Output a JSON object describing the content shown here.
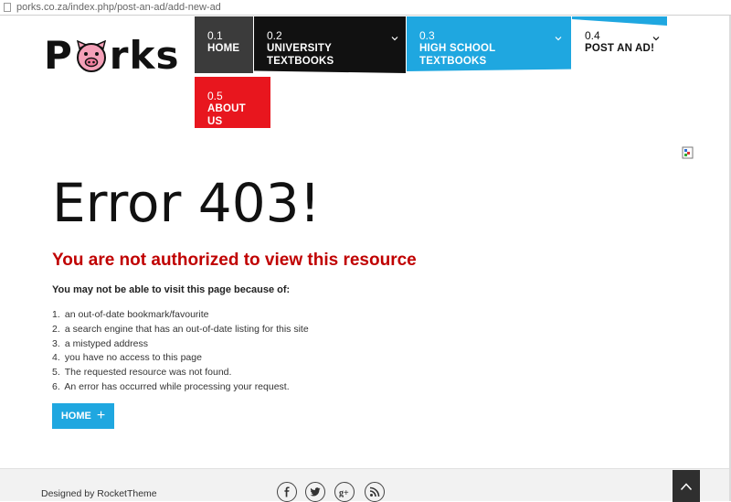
{
  "browser": {
    "url": "porks.co.za/index.php/post-an-ad/add-new-ad"
  },
  "logo": {
    "text_left": "P",
    "text_right": "rks"
  },
  "nav": [
    {
      "num": "0.1",
      "label": "HOME"
    },
    {
      "num": "0.2",
      "label": "UNIVERSITY TEXTBOOKS"
    },
    {
      "num": "0.3",
      "label": "HIGH SCHOOL TEXTBOOKS"
    },
    {
      "num": "0.4",
      "label": "POST AN AD!"
    },
    {
      "num": "0.5",
      "label": "ABOUT US"
    }
  ],
  "error": {
    "title": "Error 403!",
    "subtitle": "You are not authorized to view this resource",
    "intro": "You may not be able to visit this page because of:",
    "reasons": [
      {
        "n": "1.",
        "text": "an out-of-date bookmark/favourite"
      },
      {
        "n": "2.",
        "text": "a search engine that has an out-of-date listing for this site"
      },
      {
        "n": "3.",
        "text": "a mistyped address"
      },
      {
        "n": "4.",
        "text": "you have no access to this page"
      },
      {
        "n": "5.",
        "text": "The requested resource was not found."
      },
      {
        "n": "6.",
        "text": "An error has occurred while processing your request."
      }
    ],
    "home_button": "HOME",
    "home_button_plus": "+"
  },
  "footer": {
    "credit": "Designed by RocketTheme"
  },
  "icons": {
    "social": [
      "facebook-icon",
      "twitter-icon",
      "google-plus-icon",
      "rss-icon"
    ],
    "to_top": "arrow-up-icon"
  },
  "colors": {
    "accent_blue": "#1fa7e0",
    "accent_red": "#e8161e",
    "error_red": "#c00000",
    "pig_pink": "#f4a0b8"
  }
}
